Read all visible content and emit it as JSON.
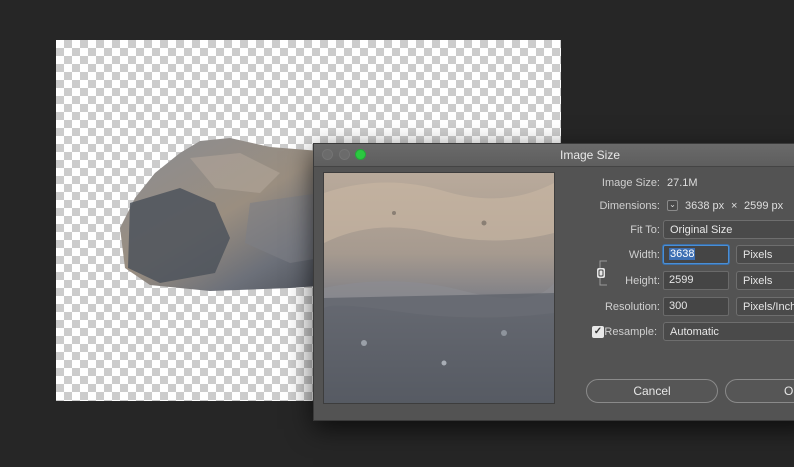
{
  "dialog": {
    "title": "Image Size",
    "image_size_label": "Image Size:",
    "image_size_value": "27.1M",
    "dimensions_label": "Dimensions:",
    "dimensions_width": "3638 px",
    "dimensions_times": "×",
    "dimensions_height": "2599 px",
    "fit_to_label": "Fit To:",
    "fit_to_value": "Original Size",
    "width_label": "Width:",
    "width_value": "3638",
    "width_unit": "Pixels",
    "height_label": "Height:",
    "height_value": "2599",
    "height_unit": "Pixels",
    "resolution_label": "Resolution:",
    "resolution_value": "300",
    "resolution_unit": "Pixels/Inch",
    "resample_label": "Resample:",
    "resample_checked": true,
    "resample_value": "Automatic",
    "cancel_label": "Cancel",
    "ok_label": "OK"
  },
  "icons": {
    "dimensions_toggle": "chevron-down-icon",
    "link": "chain-link-icon",
    "resample_check": "checkmark-icon"
  },
  "colors": {
    "app_background": "#262626",
    "dialog_background": "#535353",
    "zoom_button": "#2bc840",
    "selection": "#3d6fb3"
  }
}
